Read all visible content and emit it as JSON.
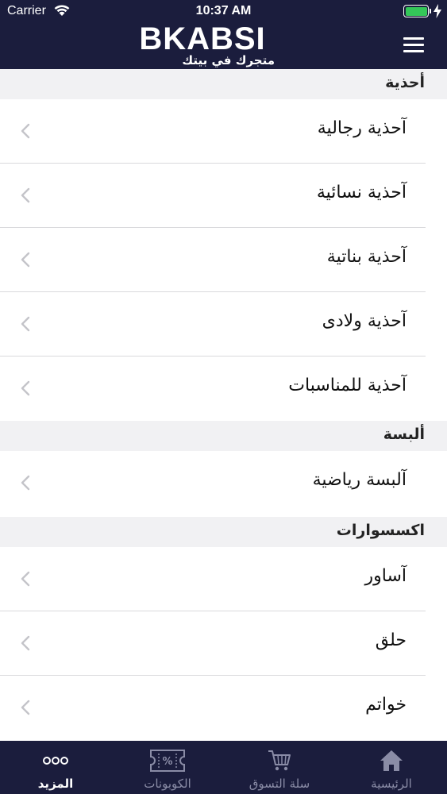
{
  "status_bar": {
    "carrier": "Carrier",
    "time": "10:37 AM"
  },
  "header": {
    "logo_text": "BKABSI",
    "logo_tagline": "متجرك في بيتك",
    "menu_icon": "hamburger-menu-icon"
  },
  "sections": [
    {
      "title": "أحذية",
      "items": [
        {
          "label": "آحذية رجالية"
        },
        {
          "label": "آحذية نسائية"
        },
        {
          "label": "آحذية بناتية"
        },
        {
          "label": "آحذية ولادى"
        },
        {
          "label": "آحذية للمناسبات"
        }
      ]
    },
    {
      "title": "ألبسة",
      "items": [
        {
          "label": "آلبسة رياضية"
        }
      ]
    },
    {
      "title": "اكسسوارات",
      "items": [
        {
          "label": "آساور"
        },
        {
          "label": "حلق"
        },
        {
          "label": "خواتم"
        }
      ]
    }
  ],
  "tabbar": {
    "active": "more",
    "tabs": [
      {
        "id": "home",
        "label": "الرئيسية",
        "icon": "home-icon"
      },
      {
        "id": "cart",
        "label": "سلة التسوق",
        "icon": "cart-icon"
      },
      {
        "id": "coupons",
        "label": "الكوبونات",
        "icon": "coupon-icon"
      },
      {
        "id": "more",
        "label": "المزيد",
        "icon": "more-dots-icon"
      }
    ]
  },
  "colors": {
    "header_bg": "#1b1d3d",
    "section_bg": "#f1f1f3",
    "tab_inactive": "#8a8ca6",
    "battery": "#34c759"
  }
}
